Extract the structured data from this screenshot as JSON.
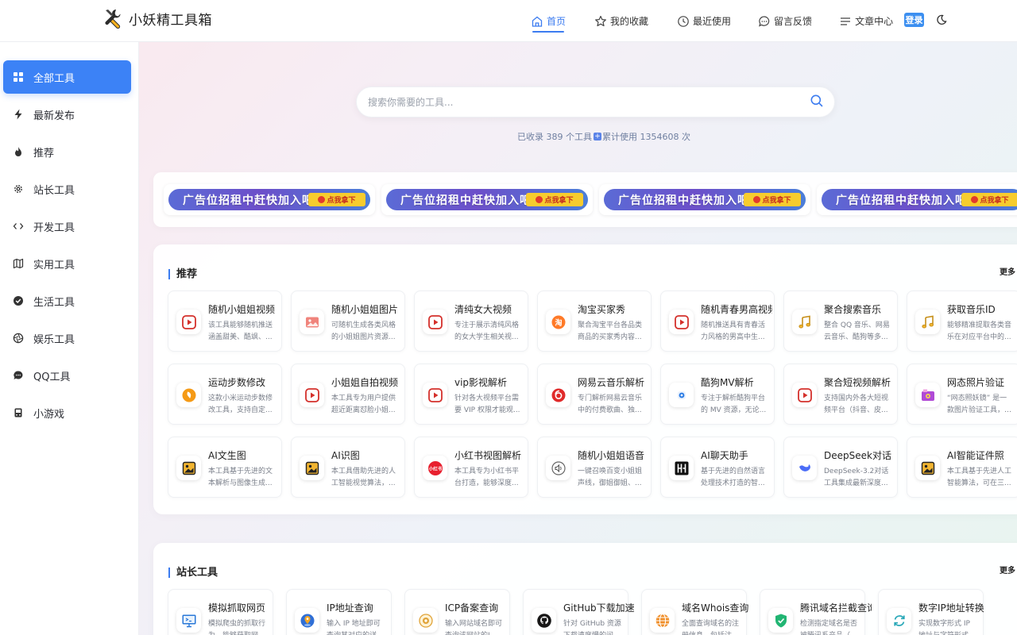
{
  "app": {
    "title": "小妖精工具箱"
  },
  "nav": [
    {
      "label": "首页",
      "icon": "home-icon",
      "active": true
    },
    {
      "label": "我的收藏",
      "icon": "star-icon"
    },
    {
      "label": "最近使用",
      "icon": "clock-icon"
    },
    {
      "label": "留言反馈",
      "icon": "chat-icon"
    },
    {
      "label": "文章中心",
      "icon": "menu-icon"
    }
  ],
  "login_label": "登录",
  "sidebar": [
    {
      "label": "全部工具",
      "icon": "grid-icon",
      "active": true
    },
    {
      "label": "最新发布",
      "icon": "lightning-icon"
    },
    {
      "label": "推荐",
      "icon": "fire-icon"
    },
    {
      "label": "站长工具",
      "icon": "gear-icon"
    },
    {
      "label": "开发工具",
      "icon": "code-icon"
    },
    {
      "label": "实用工具",
      "icon": "map-icon"
    },
    {
      "label": "生活工具",
      "icon": "check-circle-icon"
    },
    {
      "label": "娱乐工具",
      "icon": "aperture-icon"
    },
    {
      "label": "QQ工具",
      "icon": "message-icon"
    },
    {
      "label": "小游戏",
      "icon": "gamepad-icon"
    }
  ],
  "search": {
    "placeholder": "搜索你需要的工具..."
  },
  "stats": {
    "prefix": "已收录",
    "tool_count": "389",
    "tools_suffix": "个工具",
    "usage_prefix": "累计使用",
    "usage_count": "1354608",
    "usage_suffix": "次"
  },
  "ads": [
    {
      "text": "广告位招租中赶快加入吧",
      "button": "点我拿下"
    },
    {
      "text": "广告位招租中赶快加入吧",
      "button": "点我拿下"
    },
    {
      "text": "广告位招租中赶快加入吧",
      "button": "点我拿下"
    },
    {
      "text": "广告位招租中赶快加入吧",
      "button": "点我拿下"
    }
  ],
  "recommend": {
    "title": "推荐",
    "more": "更多",
    "cards": [
      {
        "title": "随机小姐姐视频",
        "desc": "该工具能够随机推送涵盖甜美、酷飒、...",
        "icon": "video-play-icon"
      },
      {
        "title": "随机小姐姐图片",
        "desc": "可随机生成各类风格的小姐姐图片资源...",
        "icon": "image-icon"
      },
      {
        "title": "清纯女大视频",
        "desc": "专注于展示清纯风格的女大学生相关视...",
        "icon": "video-play-icon"
      },
      {
        "title": "淘宝买家秀",
        "desc": "聚合淘宝平台各品类商品的买家秀内容...",
        "icon": "taobao-icon"
      },
      {
        "title": "随机青春男高视频",
        "desc": "随机推送具有青春活力风格的男高中生...",
        "icon": "video-play-icon"
      },
      {
        "title": "聚合搜索音乐",
        "desc": "整合 QQ 音乐、网易云音乐、酷狗等多...",
        "icon": "music-note-icon"
      },
      {
        "title": "获取音乐ID",
        "desc": "能够精准提取各类音乐在对应平台中的...",
        "icon": "music-note-icon"
      },
      {
        "title": "运动步数修改",
        "desc": "这款小米运动步数修改工具，支持自定...",
        "icon": "sport-icon"
      },
      {
        "title": "小姐姐自拍视频",
        "desc": "本工具专为用户提供超近距离怼脸小姐...",
        "icon": "video-play-icon"
      },
      {
        "title": "vip影视解析",
        "desc": "针对各大视频平台需要 VIP 权限才能观...",
        "icon": "video-play-icon"
      },
      {
        "title": "网易云音乐解析",
        "desc": "专门解析网易云音乐中的付费歌曲、独...",
        "icon": "netease-icon"
      },
      {
        "title": "酷狗MV解析",
        "desc": "专注于解析酷狗平台的 MV 资源，无论...",
        "icon": "kugou-icon"
      },
      {
        "title": "聚合短视频解析",
        "desc": "支持国内外各大短视频平台（抖音、皮...",
        "icon": "video-play-icon"
      },
      {
        "title": "网态照片验证",
        "desc": "“网态照妖镜” 是一款图片验证工具，支...",
        "icon": "photo-verify-icon"
      },
      {
        "title": "AI文生图",
        "desc": "本工具基于先进的文本解析与图像生成...",
        "icon": "picture-icon"
      },
      {
        "title": "AI识图",
        "desc": "本工具借助先进的人工智能视觉算法，...",
        "icon": "picture-icon"
      },
      {
        "title": "小红书视图解析",
        "desc": "本工具专为小红书平台打造，能够深度...",
        "icon": "xiaohongshu-icon"
      },
      {
        "title": "随机小姐姐语音",
        "desc": "一键召唤百变小姐姐声线，御姐御姐、...",
        "icon": "speaker-icon"
      },
      {
        "title": "AI聊天助手",
        "desc": "基于先进的自然语言处理技术打造的智...",
        "icon": "ai-chat-icon"
      },
      {
        "title": "DeepSeek对话",
        "desc": "DeepSeek-3.2对话工具集成最新深度...",
        "icon": "deepseek-icon"
      },
      {
        "title": "AI智能证件照",
        "desc": "本工具基于先进人工智能算法，可在三...",
        "icon": "picture-icon"
      }
    ]
  },
  "webmaster": {
    "title": "站长工具",
    "more": "更多",
    "cards": [
      {
        "title": "模拟抓取网页",
        "desc": "模拟爬虫的抓取行为，能够获取网页...",
        "icon": "monitor-icon"
      },
      {
        "title": "IP地址查询",
        "desc": "输入 IP 地址即可查询其对应的详细...",
        "icon": "location-icon"
      },
      {
        "title": "ICP备案查询",
        "desc": "输入网站域名即可查询该网站的I...",
        "icon": "icp-icon"
      },
      {
        "title": "GitHub下载加速",
        "desc": "针对 GitHub 资源下载速度慢的问...",
        "icon": "github-icon"
      },
      {
        "title": "域名Whois查询",
        "desc": "全面查询域名的注册信息，包括注...",
        "icon": "globe-icon"
      },
      {
        "title": "腾讯域名拦截查询",
        "desc": "检测指定域名是否被腾讯系产品（如微...",
        "icon": "shield-icon"
      },
      {
        "title": "数字IP地址转换",
        "desc": "实现数字形式 IP 地址与字符形式 IP 地址之间的互相转...",
        "icon": "refresh-icon"
      }
    ]
  }
}
